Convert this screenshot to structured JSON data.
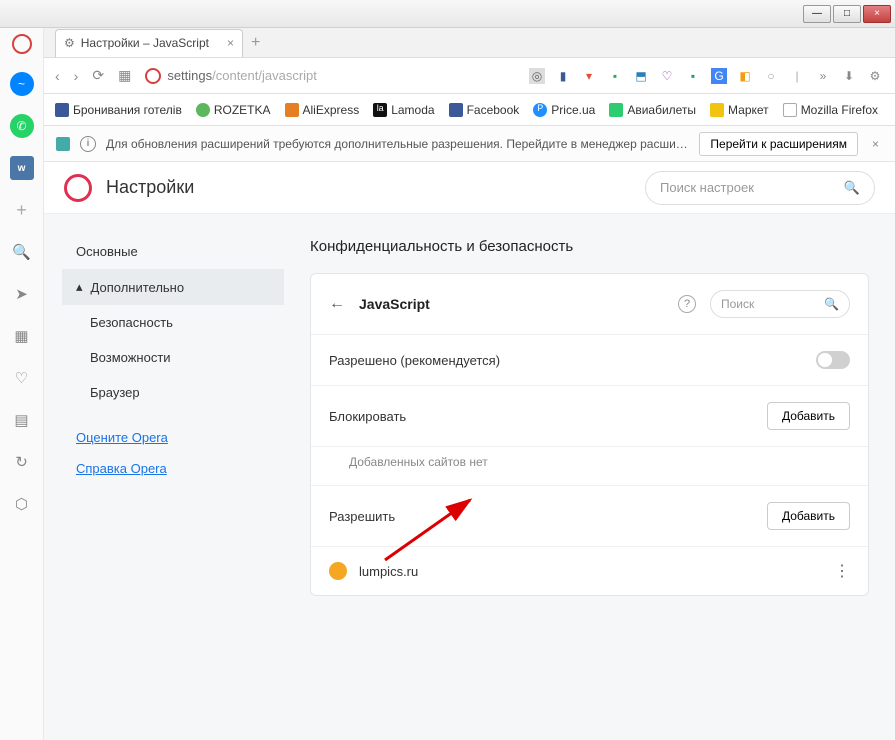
{
  "window": {
    "min": "—",
    "max": "□",
    "close": "×"
  },
  "tab": {
    "title": "Настройки – JavaScript"
  },
  "address": {
    "prefix": "settings",
    "path": "/content/javascript"
  },
  "bookmarks": [
    {
      "label": "Бронивания готелів",
      "color": "#3b5998"
    },
    {
      "label": "ROZETKA",
      "color": "#5cb85c"
    },
    {
      "label": "AliExpress",
      "color": "#e67e22"
    },
    {
      "label": "Lamoda",
      "color": "#111"
    },
    {
      "label": "Facebook",
      "color": "#3b5998"
    },
    {
      "label": "Price.ua",
      "color": "#1e90ff"
    },
    {
      "label": "Авиабилеты",
      "color": "#2ecc71"
    },
    {
      "label": "Маркет",
      "color": "#f1c40f"
    },
    {
      "label": "Mozilla Firefox",
      "color": "#888"
    }
  ],
  "notification": {
    "text": "Для обновления расширений требуются дополнительные разрешения. Перейдите в менеджер расширений для подт...",
    "button": "Перейти к расширениям"
  },
  "page": {
    "title": "Настройки",
    "search_placeholder": "Поиск настроек"
  },
  "sidebar": {
    "items": [
      {
        "label": "Основные"
      },
      {
        "label": "Дополнительно",
        "active": true
      },
      {
        "label": "Безопасность"
      },
      {
        "label": "Возможности"
      },
      {
        "label": "Браузер"
      }
    ],
    "links": [
      {
        "label": "Оцените Opera"
      },
      {
        "label": "Справка Opera"
      }
    ]
  },
  "section": {
    "title": "Конфиденциальность и безопасность",
    "subpage": "JavaScript",
    "search_placeholder": "Поиск",
    "allowed_label": "Разрешено (рекомендуется)",
    "block": {
      "title": "Блокировать",
      "add": "Добавить",
      "empty": "Добавленных сайтов нет"
    },
    "allow": {
      "title": "Разрешить",
      "add": "Добавить",
      "sites": [
        {
          "name": "lumpics.ru"
        }
      ]
    }
  }
}
